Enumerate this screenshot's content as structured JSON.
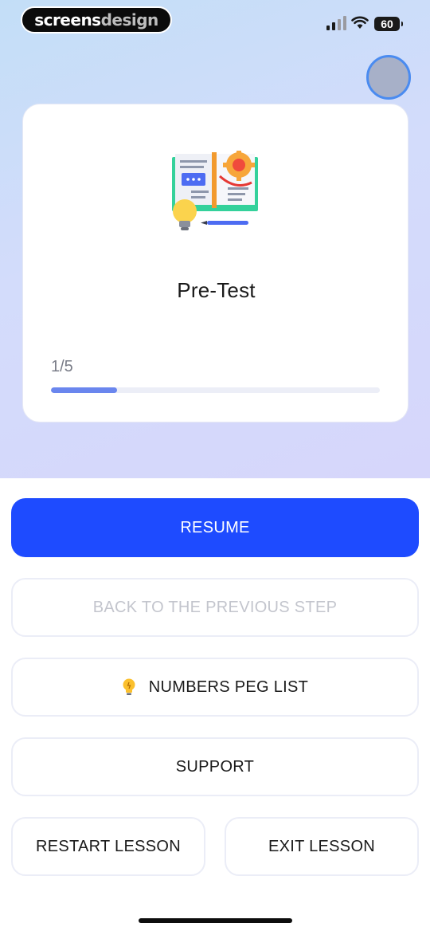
{
  "status_bar": {
    "brand_part1": "screens",
    "brand_part2": "design",
    "battery": "60",
    "icons": [
      "cellular-signal-icon",
      "wifi-icon",
      "battery-icon"
    ]
  },
  "profile": {
    "icon": "avatar"
  },
  "card": {
    "illustration": "book-lesson-illustration",
    "title": "Pre-Test",
    "progress_text": "1/5",
    "progress_fraction": 0.2
  },
  "buttons": {
    "resume": "RESUME",
    "back": "BACK TO THE PREVIOUS STEP",
    "peg_list": "NUMBERS PEG LIST",
    "peg_icon": "lightbulb-icon",
    "support": "SUPPORT",
    "restart": "RESTART LESSON",
    "exit": "EXIT LESSON"
  },
  "colors": {
    "primary": "#1e4bff",
    "progress": "#6a86ee",
    "disabled_text": "#c3c5cd"
  }
}
